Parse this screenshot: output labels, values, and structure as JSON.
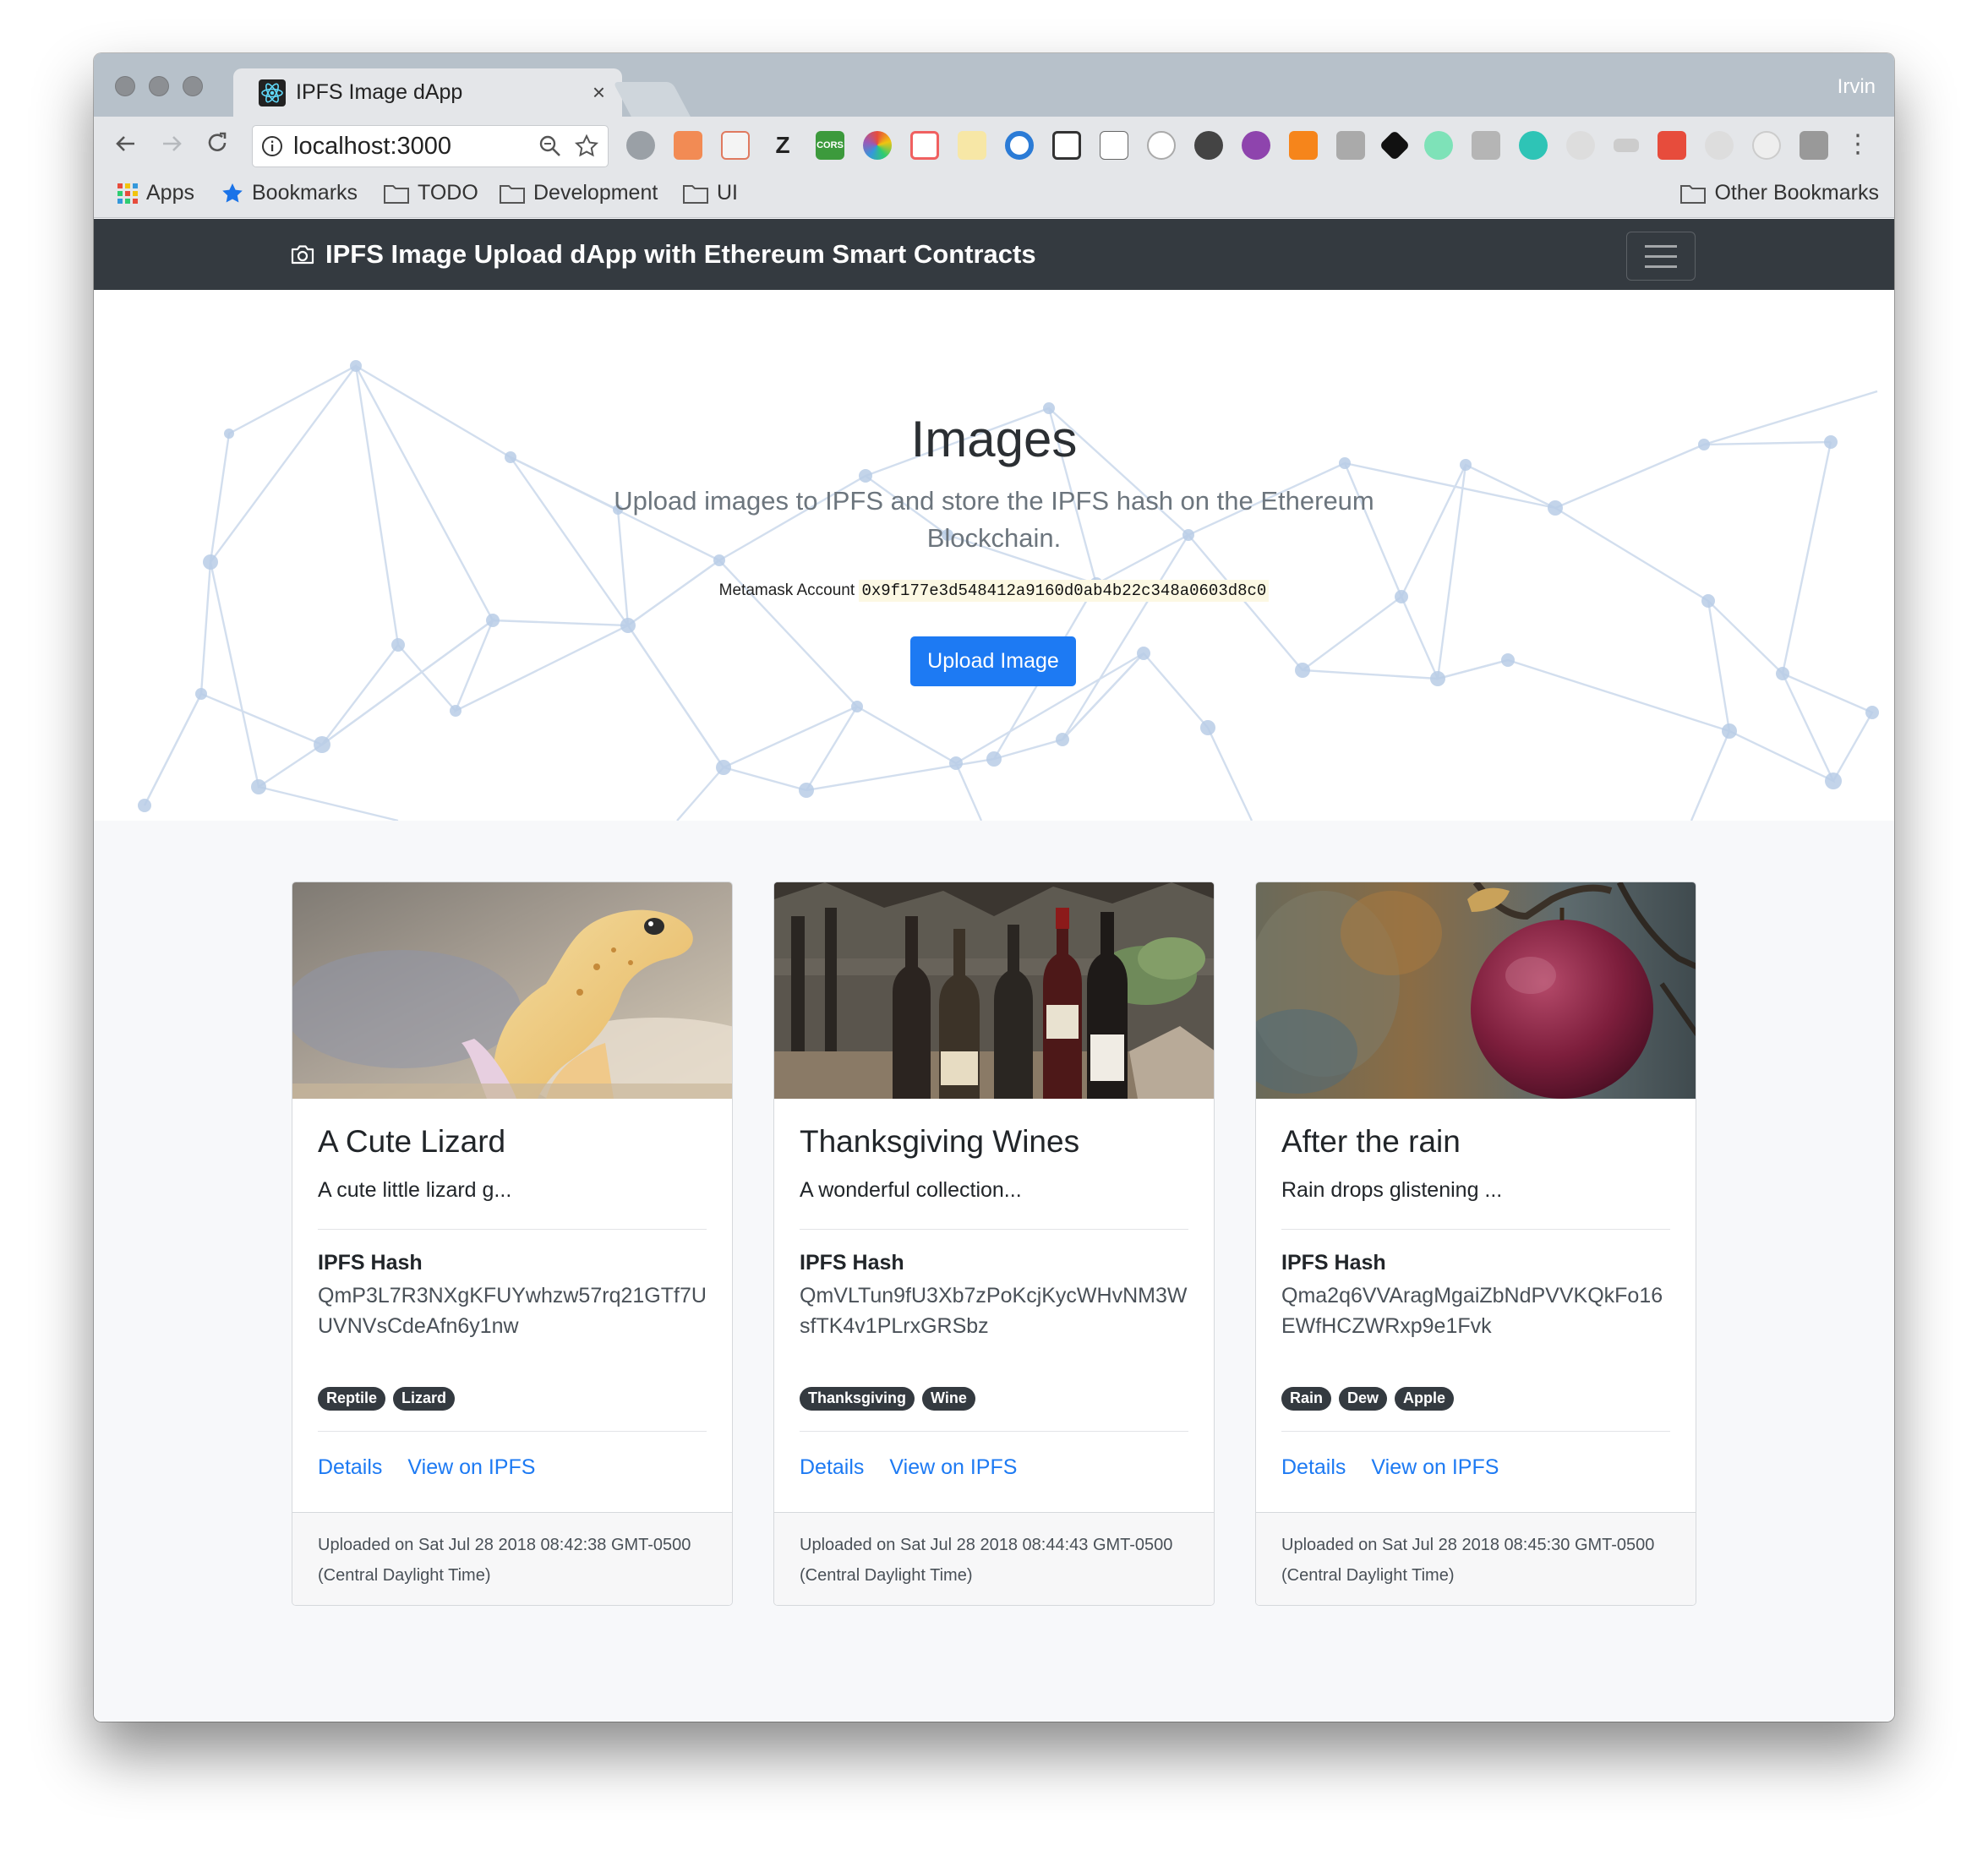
{
  "browser": {
    "tab_title": "IPFS Image dApp",
    "tab_close": "×",
    "profile": "Irvin",
    "url": "localhost:3000",
    "bookmarks": [
      "Apps",
      "Bookmarks",
      "TODO",
      "Development",
      "UI"
    ],
    "other_bookmarks": "Other Bookmarks",
    "extension_labels": [
      "Z",
      "CORS"
    ],
    "menu": "⋮"
  },
  "navbar": {
    "brand": "IPFS Image Upload dApp with Ethereum Smart Contracts"
  },
  "hero": {
    "title": "Images",
    "lead": "Upload images to IPFS and store the IPFS hash on the Ethereum Blockchain.",
    "account_label": "Metamask Account",
    "account_value": "0x9f177e3d548412a9160d0ab4b22c348a0603d8c0",
    "upload_button": "Upload Image"
  },
  "cards": [
    {
      "title": "A Cute Lizard",
      "text": "A cute little lizard g...",
      "hash_label": "IPFS Hash",
      "hash": "QmP3L7R3NXgKFUYwhzw57rq21GTf7UUVNVsCdeAfn6y1nw",
      "tags": [
        "Reptile",
        "Lizard"
      ],
      "details": "Details",
      "view": "View on IPFS",
      "uploaded": "Uploaded on Sat Jul 28 2018 08:42:38 GMT-0500 (Central Daylight Time)"
    },
    {
      "title": "Thanksgiving Wines",
      "text": "A wonderful collection...",
      "hash_label": "IPFS Hash",
      "hash": "QmVLTun9fU3Xb7zPoKcjKycWHvNM3WsfTK4v1PLrxGRSbz",
      "tags": [
        "Thanksgiving",
        "Wine"
      ],
      "details": "Details",
      "view": "View on IPFS",
      "uploaded": "Uploaded on Sat Jul 28 2018 08:44:43 GMT-0500 (Central Daylight Time)"
    },
    {
      "title": "After the rain",
      "text": "Rain drops glistening ...",
      "hash_label": "IPFS Hash",
      "hash": "Qma2q6VVAragMgaiZbNdPVVKQkFo16EWfHCZWRxp9e1Fvk",
      "tags": [
        "Rain",
        "Dew",
        "Apple"
      ],
      "details": "Details",
      "view": "View on IPFS",
      "uploaded": "Uploaded on Sat Jul 28 2018 08:45:30 GMT-0500 (Central Daylight Time)"
    }
  ],
  "colors": {
    "primary": "#1d7af3",
    "navbar": "#343a40",
    "badge": "#343a40"
  }
}
